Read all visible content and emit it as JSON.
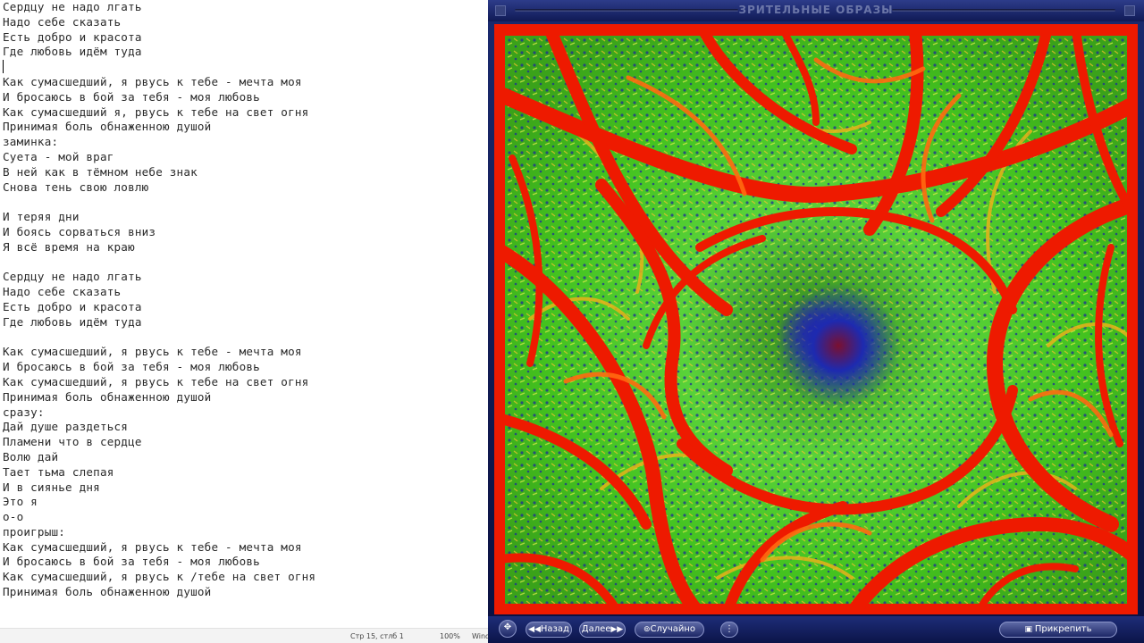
{
  "editor": {
    "lines": [
      "Сердцу не надо лгать",
      "Надо себе сказать",
      "Есть добро и красота",
      "Где любовь идём туда",
      "",
      "Как сумасшедший, я рвусь к тебе - мечта моя",
      "И бросаюсь в бой за тебя - моя любовь",
      "Как сумасшедший я, рвусь к тебе на свет огня",
      "Принимая боль обнаженною душой",
      "заминка:",
      "Суета - мой враг",
      "В ней как в тёмном небе знак",
      "Снова тень свою ловлю",
      "",
      "И теряя дни",
      "И боясь сорваться вниз",
      "Я всё время на краю",
      "",
      "Сердцу не надо лгать",
      "Надо себе сказать",
      "Есть добро и красота",
      "Где любовь идём туда",
      "",
      "Как сумасшедший, я рвусь к тебе - мечта моя",
      "И бросаюсь в бой за тебя - моя любовь",
      "Как сумасшедший, я рвусь к тебе на свет огня",
      "Принимая боль обнаженною душой",
      "сразу:",
      "Дай душе раздеться",
      "Пламени что в сердце",
      "Волю дай",
      "Тает тьма слепая",
      "И в сиянье дня",
      "Это я",
      "о-о",
      "проигрыш:",
      "Как сумасшедший, я рвусь к тебе - мечта моя",
      "И бросаюсь в бой за тебя - моя любовь",
      "Как сумасшедший, я рвусь к /тебе на свет огня",
      "Принимая боль обнаженною душой"
    ]
  },
  "statusbar": {
    "position": "Стр 15, стлб 1",
    "zoom": "100%",
    "encoding": "Wind"
  },
  "player": {
    "title": "ЗРИТЕЛЬНЫЕ ОБРАЗЫ",
    "controls": {
      "nav_icon": "arrows-move-icon",
      "back_label": "Назад",
      "next_label": "Далее",
      "random_label": "Случайно",
      "attach_label": "Прикрепить"
    },
    "colors": {
      "frame": "#c40000",
      "accent": "#1d2766"
    }
  }
}
